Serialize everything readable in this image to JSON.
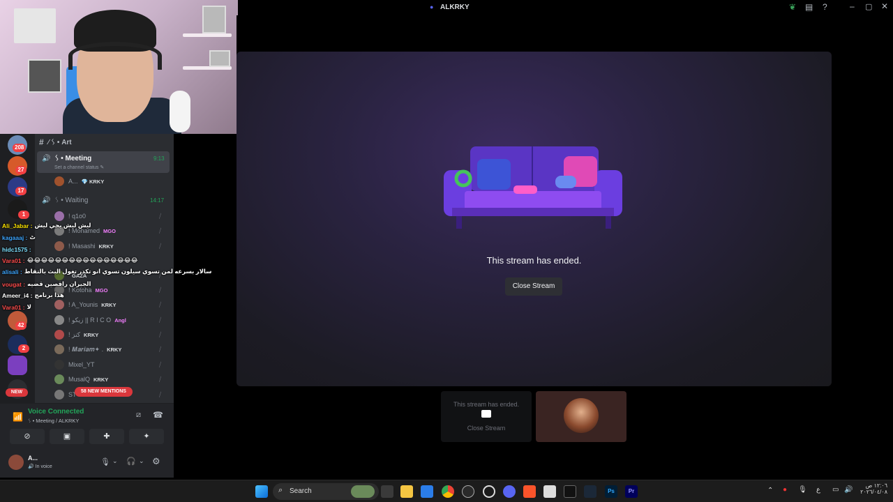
{
  "window": {
    "title": "ALKRKY"
  },
  "server_badges": [
    "208",
    "27",
    "17",
    "1",
    "42",
    "2"
  ],
  "new_badge": "NEW",
  "channels": {
    "art": "⁄ ᛊ • Art",
    "meeting": "ᛊ • Meeting",
    "meeting_time": "9:13",
    "meeting_status": "Set a channel status",
    "meeting_member": "A...",
    "meeting_member_tag": "KRKY",
    "waiting": "ᛊ • Waiting",
    "waiting_time": "14:17"
  },
  "members": [
    {
      "name": "! q1o0",
      "tag": ""
    },
    {
      "name": "! Mohamed",
      "tag": "MGO"
    },
    {
      "name": "! Masashi",
      "tag": "KRKY"
    },
    {
      "name": "",
      "tag": "GAZA"
    },
    {
      "name": "! Kotoha",
      "tag": "MGO"
    },
    {
      "name": "! A_Younis",
      "tag": "KRKY"
    },
    {
      "name": "! زيكو || R I C O",
      "tag": "Angl"
    },
    {
      "name": "! كنز",
      "tag": "KRKY"
    },
    {
      "name": "! 𝑴𝒂𝒓𝒊𝒂𝒎✦ .",
      "tag": "KRKY"
    },
    {
      "name": "Mixel_YT",
      "tag": ""
    },
    {
      "name": "MusalQ",
      "tag": "KRKY"
    },
    {
      "name": "ST",
      "tag": ""
    }
  ],
  "chat": [
    {
      "user": "Ali_Jabar :",
      "msg": "ليش ليش يحي ليش",
      "color": "#ffe600"
    },
    {
      "user": "kagaaaj :",
      "msg": "ٹ",
      "color": "#3ea6ff"
    },
    {
      "user": "hidc1575 :",
      "msg": "",
      "color": "#7ce0ff"
    },
    {
      "user": "Vara01 :",
      "msg": "😂😂😂😂😂😂😂😂😂😂😂😂😂😂😂😂",
      "color": "#ff4d4d"
    },
    {
      "user": "alisali :",
      "msg": "سالار بسرعه لمن تسوي سيلون تسوي انو تكدر تغول البث بالتقاط",
      "color": "#3ea6ff"
    },
    {
      "user": "vougat :",
      "msg": "الجيران راقصين قضيه",
      "color": "#ff4d4d"
    },
    {
      "user": "Ameer_i4 :",
      "msg": "هذا برنامج",
      "color": "#ffffff"
    },
    {
      "user": "Vara01 :",
      "msg": "لا",
      "color": "#ff4d4d"
    }
  ],
  "mentions": "58 NEW MENTIONS",
  "voice": {
    "status": "Voice Connected",
    "location": "ᛊ • Meeting / ALKRKY"
  },
  "user": {
    "name": "A...",
    "status": "In voice"
  },
  "stream": {
    "ended_text": "This stream has ended.",
    "close_label": "Close Stream"
  },
  "tiles": {
    "ended_text": "This stream has ended.",
    "close_label": "Close Stream"
  },
  "taskbar": {
    "search_label": "Search",
    "lang": "ع",
    "time": "١٢:٠٦ ص",
    "date": "٢٠٢٦/٠٤/٠٨"
  },
  "colors": {
    "discord_bg": "#2b2d31",
    "accent_green": "#23a55a",
    "danger": "#da373c"
  }
}
